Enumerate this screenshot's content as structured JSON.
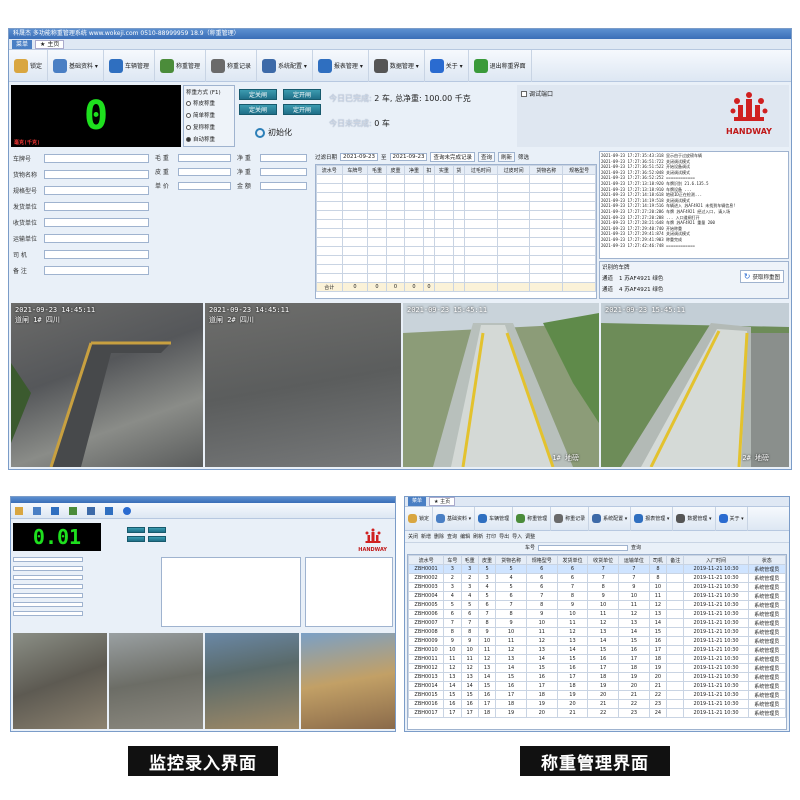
{
  "top_app": {
    "title": "科晟杰 多功能称重管理系统 www.wokeji.com 0510-88999959 18.9（称重管理）",
    "menu_label": "菜单",
    "tab_label": "主页",
    "toolbar": [
      {
        "label": "锁定",
        "icon": "lock-icon",
        "color": "#d9a640"
      },
      {
        "label": "基础资料 ▾",
        "icon": "folder-icon",
        "color": "#4a7fc4"
      },
      {
        "label": "车辆管理",
        "icon": "truck-icon",
        "color": "#2f6fc0"
      },
      {
        "label": "称重管理",
        "icon": "scale-icon",
        "color": "#4b8c3a"
      },
      {
        "label": "称重记录",
        "icon": "record-icon",
        "color": "#6a6a6a"
      },
      {
        "label": "系统配置 ▾",
        "icon": "gear-icon",
        "color": "#3d6aa8"
      },
      {
        "label": "报表管理 ▾",
        "icon": "report-icon",
        "color": "#2f6fc0"
      },
      {
        "label": "数据管理 ▾",
        "icon": "database-icon",
        "color": "#555555"
      },
      {
        "label": "关于 ▾",
        "icon": "info-icon",
        "color": "#2a6bd0"
      },
      {
        "label": "退出称重界面",
        "icon": "exit-icon",
        "color": "#3a9a3a"
      }
    ],
    "weight_display": "0",
    "scale_status_bar": "毫克(千克)",
    "weigh_mode": {
      "title": "称重方式 (F1)",
      "options": [
        "称皮称重",
        "简单称重",
        "复称称重",
        "自动称重"
      ],
      "selected": 3
    },
    "direction_buttons": [
      "定关闸",
      "定开闸",
      "定关闸",
      "定开闸"
    ],
    "init_label": "初始化",
    "today_count_label": "今日已完成:",
    "today_count_value": "2 车, 总净重: 100.00 千克",
    "today_pending_label": "今日未完成:",
    "today_pending_value": "0 车",
    "test_port_label": "调试端口",
    "brand": "HANDWAY",
    "form_left": [
      "车牌号",
      "货物名称",
      "规格型号",
      "发货单位",
      "收货单位",
      "运输单位",
      "司 机",
      "备 注"
    ],
    "form_mid": [
      "毛 重",
      "皮 重",
      "单 价"
    ],
    "form_mid2": [
      "净 重",
      "净 重",
      "金 额"
    ],
    "filter": {
      "label": "过滤日期",
      "from": "2021-09-23",
      "to_label": "至",
      "to": "2021-09-23",
      "finished_select": "查询未完成记录",
      "query": "查询",
      "refresh": "刷新",
      "other": "筛选"
    },
    "table_headers": [
      "流水号",
      "车牌号",
      "毛重",
      "皮重",
      "净重",
      "扣",
      "实重",
      "货",
      "过毛时间",
      "过皮时间",
      "货物名称",
      "规格型号"
    ],
    "table_footer": [
      "合计",
      "0",
      "0",
      "0",
      "0",
      "0"
    ],
    "log_lines": [
      "2021-09-23 17:27:35:43:318 显示由于过皮磅车辆",
      "2021-09-23 17:27:36:51:722 关闭调试模式",
      "2021-09-23 17:27:36:51:522 开始设备调试",
      "2021-09-23 17:27:36:52:048 关闭调试模式",
      "2021-09-23 17:27:36:52:252 ============",
      "2021-09-23 17:27:13:18:920 车牌识别 21.6.135.5",
      "2021-09-23 17:27:13:18:910 车牌设备 ...",
      "2021-09-23 17:27:14:18:618 地磅ID正在检测...",
      "2021-09-23 17:27:14:19:518 关闭调试模式",
      "2021-09-23 17:27:14:19:516 车辆进入 苏AF4921 未找到车辆信息!",
      "2021-09-23 17:27:27:20:286 车牌 苏AF4921 经过入口, 请入场",
      "2021-09-23 17:27:27:20:208 ... 入口道闸打开",
      "2021-09-23 17:27:28:21:648 车牌 苏AF4921 重量 200",
      "2021-09-23 17:27:29:40:740 开始称重",
      "2021-09-23 17:27:29:41:874 关闭调试模式",
      "2021-09-23 17:27:29:41:903 称重完成",
      "2021-09-23 17:27:42:46:748 ============"
    ],
    "plate_title": "识别的车牌",
    "plates": [
      {
        "channel": "通道",
        "no": "1 苏AF4921 绿色"
      },
      {
        "channel": "通道",
        "no": "4 苏AF4921 绿色"
      }
    ],
    "capture_button": "获取称重图",
    "cams": [
      {
        "ts": "2021-09-23 14:45:11",
        "name": "道闸 1# 四川"
      },
      {
        "ts": "2021-09-23 14:45:11",
        "name": "道闸 2# 四川"
      },
      {
        "ts": "2021-09-23 15:45:11",
        "name": "1# 地磅"
      },
      {
        "ts": "2021-09-23 15:45:11",
        "name": "2# 地磅"
      }
    ]
  },
  "mini_left": {
    "weight_display": "0.01",
    "brand": "HANDWAY"
  },
  "mini_right": {
    "menu_label": "菜单",
    "tab_label": "主页",
    "toolbar": [
      "锁定",
      "基础资料 ▾",
      "车辆管理",
      "称重管理",
      "称重记录",
      "系统配置 ▾",
      "报表管理 ▾",
      "数据管理 ▾",
      "关于 ▾"
    ],
    "subtools": [
      "关闭",
      "新增",
      "删除",
      "查询",
      "编辑",
      "刷新",
      "打印",
      "导出",
      "导入",
      "调整"
    ],
    "search_label": "车号",
    "search_button": "查询",
    "headers": [
      "流水号",
      "车号",
      "毛重",
      "皮重",
      "货物名称",
      "规格型号",
      "发货单位",
      "收货单位",
      "运输单位",
      "司机",
      "备注",
      "入厂时间",
      "状态"
    ],
    "rows": [
      [
        "ZBH0001",
        "3",
        "3",
        "5",
        "5",
        "6",
        "6",
        "7",
        "7",
        "8",
        "",
        "2019-11-21 10:30",
        "系统管理员"
      ],
      [
        "ZBH0002",
        "2",
        "2",
        "3",
        "4",
        "6",
        "6",
        "7",
        "7",
        "8",
        "",
        "2019-11-21 10:30",
        "系统管理员"
      ],
      [
        "ZBH0003",
        "3",
        "3",
        "4",
        "5",
        "6",
        "7",
        "8",
        "9",
        "10",
        "",
        "2019-11-21 10:30",
        "系统管理员"
      ],
      [
        "ZBH0004",
        "4",
        "4",
        "5",
        "6",
        "7",
        "8",
        "9",
        "10",
        "11",
        "",
        "2019-11-21 10:30",
        "系统管理员"
      ],
      [
        "ZBH0005",
        "5",
        "5",
        "6",
        "7",
        "8",
        "9",
        "10",
        "11",
        "12",
        "",
        "2019-11-21 10:30",
        "系统管理员"
      ],
      [
        "ZBH0006",
        "6",
        "6",
        "7",
        "8",
        "9",
        "10",
        "11",
        "12",
        "13",
        "",
        "2019-11-21 10:30",
        "系统管理员"
      ],
      [
        "ZBH0007",
        "7",
        "7",
        "8",
        "9",
        "10",
        "11",
        "12",
        "13",
        "14",
        "",
        "2019-11-21 10:30",
        "系统管理员"
      ],
      [
        "ZBH0008",
        "8",
        "8",
        "9",
        "10",
        "11",
        "12",
        "13",
        "14",
        "15",
        "",
        "2019-11-21 10:30",
        "系统管理员"
      ],
      [
        "ZBH0009",
        "9",
        "9",
        "10",
        "11",
        "12",
        "13",
        "14",
        "15",
        "16",
        "",
        "2019-11-21 10:30",
        "系统管理员"
      ],
      [
        "ZBH0010",
        "10",
        "10",
        "11",
        "12",
        "13",
        "14",
        "15",
        "16",
        "17",
        "",
        "2019-11-21 10:30",
        "系统管理员"
      ],
      [
        "ZBH0011",
        "11",
        "11",
        "12",
        "13",
        "14",
        "15",
        "16",
        "17",
        "18",
        "",
        "2019-11-21 10:30",
        "系统管理员"
      ],
      [
        "ZBH0012",
        "12",
        "12",
        "13",
        "14",
        "15",
        "16",
        "17",
        "18",
        "19",
        "",
        "2019-11-21 10:30",
        "系统管理员"
      ],
      [
        "ZBH0013",
        "13",
        "13",
        "14",
        "15",
        "16",
        "17",
        "18",
        "19",
        "20",
        "",
        "2019-11-21 10:30",
        "系统管理员"
      ],
      [
        "ZBH0014",
        "14",
        "14",
        "15",
        "16",
        "17",
        "18",
        "19",
        "20",
        "21",
        "",
        "2019-11-21 10:30",
        "系统管理员"
      ],
      [
        "ZBH0015",
        "15",
        "15",
        "16",
        "17",
        "18",
        "19",
        "20",
        "21",
        "22",
        "",
        "2019-11-21 10:30",
        "系统管理员"
      ],
      [
        "ZBH0016",
        "16",
        "16",
        "17",
        "18",
        "19",
        "20",
        "21",
        "22",
        "23",
        "",
        "2019-11-21 10:30",
        "系统管理员"
      ],
      [
        "ZBH0017",
        "17",
        "17",
        "18",
        "19",
        "20",
        "21",
        "22",
        "23",
        "24",
        "",
        "2019-11-21 10:30",
        "系统管理员"
      ]
    ]
  },
  "captions": {
    "left": "监控录入界面",
    "right": "称重管理界面"
  }
}
